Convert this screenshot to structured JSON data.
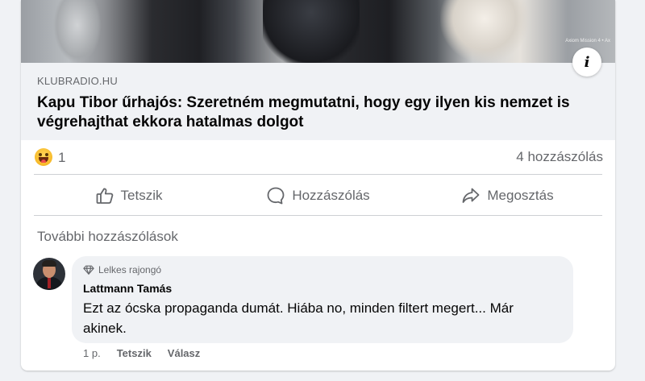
{
  "link_preview": {
    "image_caption": "Axiom Mission 4 • Ax",
    "info_icon": "info-icon",
    "domain": "KLUBRADIO.HU",
    "title": "Kapu Tibor űrhajós: Szeretném megmutatni, hogy egy ilyen kis nemzet is végrehajthat ekkora hatalmas dolgot"
  },
  "stats": {
    "reaction_icon": "laughing-emoji-icon",
    "reaction_count": "1",
    "comments_count": "4 hozzászólás"
  },
  "actions": {
    "like": {
      "label": "Tetszik",
      "icon": "thumbs-up-icon"
    },
    "comment": {
      "label": "Hozzászólás",
      "icon": "comment-bubble-icon"
    },
    "share": {
      "label": "Megosztás",
      "icon": "share-arrow-icon"
    }
  },
  "comments_section": {
    "more_label": "További hozzászólások",
    "comment": {
      "badge": "Lelkes rajongó",
      "badge_icon": "diamond-icon",
      "author": "Lattmann Tamás",
      "text": "Ezt az ócska propaganda dumát. Hiába no, minden filtert megert... Már akinek.",
      "time": "1 p.",
      "like_label": "Tetszik",
      "reply_label": "Válasz"
    }
  },
  "colors": {
    "secondary_text": "#65676b",
    "page_background": "#f0f2f5",
    "bubble_background": "#f0f2f5"
  }
}
